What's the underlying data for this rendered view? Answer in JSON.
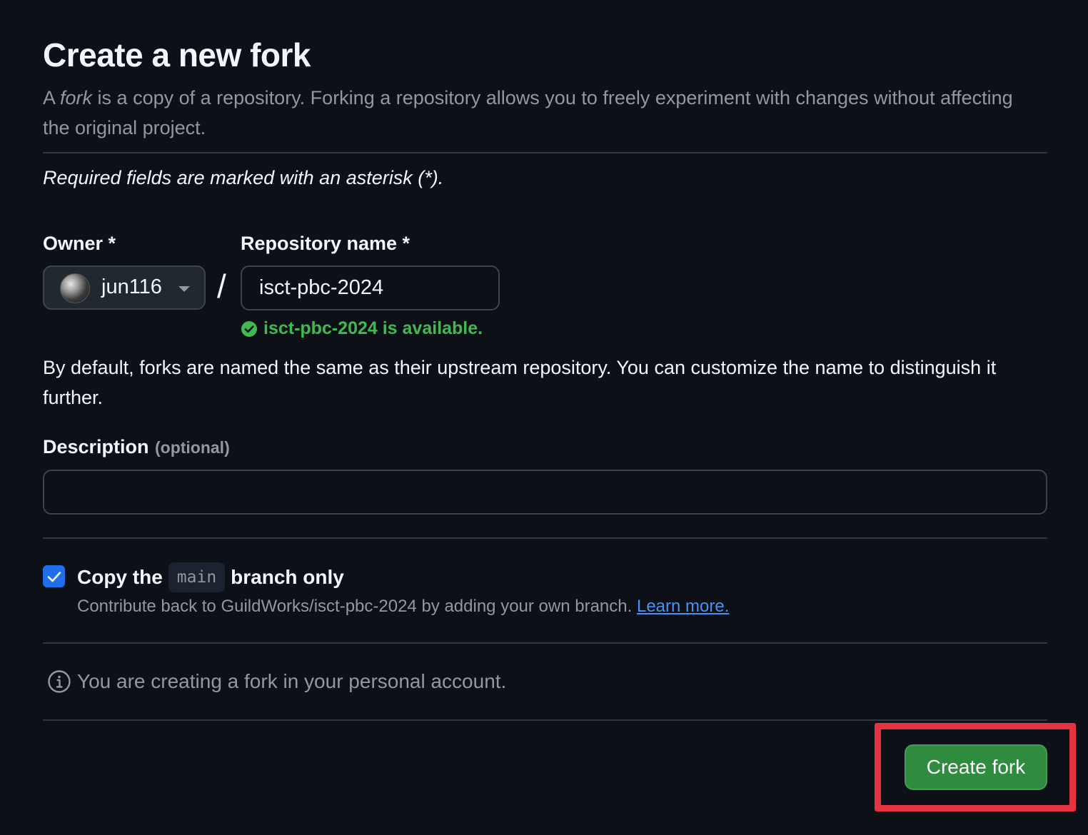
{
  "header": {
    "title": "Create a new fork",
    "subtitle_prefix": "A ",
    "subtitle_em": "fork",
    "subtitle_rest": " is a copy of a repository. Forking a repository allows you to freely experiment with changes without affecting the original project."
  },
  "required_note": "Required fields are marked with an asterisk (*).",
  "owner": {
    "label": "Owner *",
    "selected": "jun116",
    "icon": "chevron-down-icon"
  },
  "separator": "/",
  "repository": {
    "label": "Repository name *",
    "value": "isct-pbc-2024",
    "availability": "isct-pbc-2024 is available.",
    "availability_color": "#3fb950"
  },
  "naming_help": "By default, forks are named the same as their upstream repository. You can customize the name to distinguish it further.",
  "description": {
    "label": "Description",
    "optional": "(optional)",
    "value": ""
  },
  "copy_branch": {
    "checked": true,
    "label_before": "Copy the",
    "branch": "main",
    "label_after": "branch only",
    "note": "Contribute back to GuildWorks/isct-pbc-2024 by adding your own branch.",
    "link": "Learn more."
  },
  "info": {
    "text": "You are creating a fork in your personal account.",
    "icon": "info-icon"
  },
  "actions": {
    "create_label": "Create fork",
    "create_color": "#2f8c3f",
    "highlight_color": "#e5333f"
  }
}
